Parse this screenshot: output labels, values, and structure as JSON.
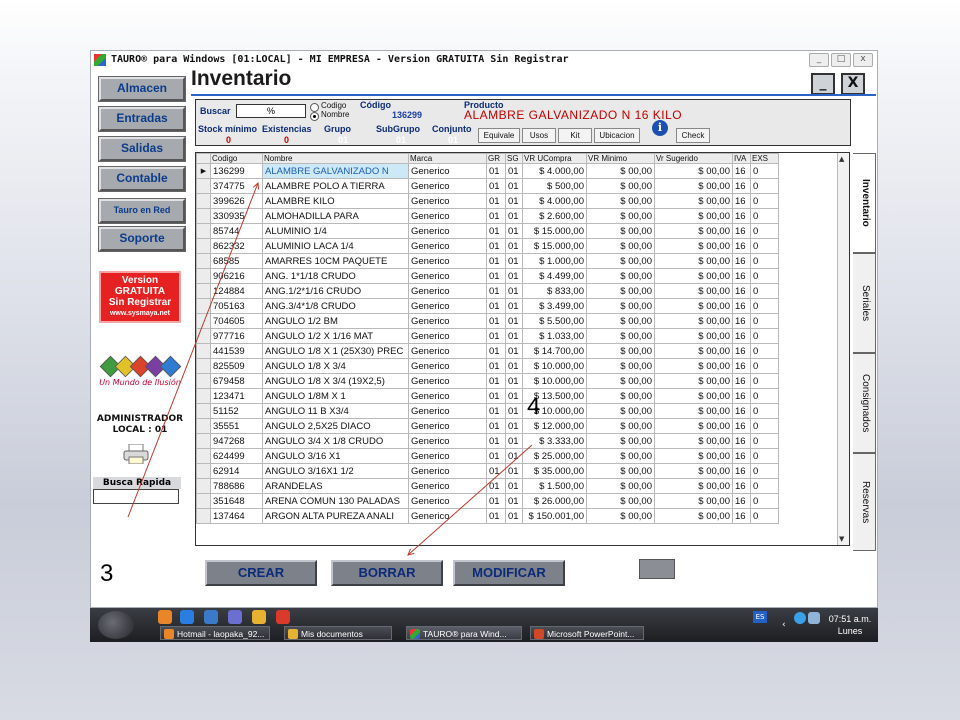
{
  "window": {
    "title": "TAURO® para Windows  [01:LOCAL] - MI EMPRESA - Version GRATUITA Sin Registrar",
    "controls": [
      "_",
      "□",
      "x"
    ]
  },
  "nav": {
    "items": [
      "Almacen",
      "Entradas",
      "Salidas",
      "Contable",
      "Tauro en Red",
      "Soporte"
    ],
    "promo": [
      "Version",
      "GRATUITA",
      "Sin Registrar",
      "www.sysmaya.net"
    ],
    "slogan": "Un Mundo de Ilusión",
    "user_line1": "ADMINISTRADOR",
    "user_line2": "LOCAL : 01",
    "quick_search_label": "Busca Rapida"
  },
  "page": {
    "title": "Inventario",
    "minimize": "_",
    "close": "X"
  },
  "header": {
    "buscar_label": "Buscar",
    "buscar_value": "%",
    "radio_codigo": "Codigo",
    "radio_nombre": "Nombre",
    "codigo_label": "Código",
    "codigo_value": "136299",
    "producto_label": "Producto",
    "producto_value": "ALAMBRE GALVANIZADO N 16 KILO",
    "stock_min_label": "Stock mínimo",
    "stock_min_value": "0",
    "existencias_label": "Existencias",
    "existencias_value": "0",
    "grupo_label": "Grupo",
    "grupo_value": "01",
    "subgrupo_label": "SubGrupo",
    "subgrupo_value": "01",
    "conjunto_label": "Conjunto",
    "conjunto_value": "01",
    "buttons": [
      "Equivale",
      "Usos",
      "Kit",
      "Ubicacion",
      "Check"
    ]
  },
  "grid": {
    "columns": [
      "Codigo",
      "Nombre",
      "Marca",
      "GR",
      "SG",
      "VR UCompra",
      "VR Minimo",
      "Vr Sugerido",
      "IVA",
      "EXS"
    ],
    "rows": [
      [
        "136299",
        "ALAMBRE GALVANIZADO N",
        "Generico",
        "01",
        "01",
        "$ 4.000,00",
        "$ 00,00",
        "$ 00,00",
        "16",
        "0"
      ],
      [
        "374775",
        "ALAMBRE POLO A TIERRA",
        "Generico",
        "01",
        "01",
        "$ 500,00",
        "$ 00,00",
        "$ 00,00",
        "16",
        "0"
      ],
      [
        "399626",
        "ALAMBRE KILO",
        "Generico",
        "01",
        "01",
        "$ 4.000,00",
        "$ 00,00",
        "$ 00,00",
        "16",
        "0"
      ],
      [
        "330935",
        "ALMOHADILLA PARA",
        "Generico",
        "01",
        "01",
        "$ 2.600,00",
        "$ 00,00",
        "$ 00,00",
        "16",
        "0"
      ],
      [
        "85744",
        "ALUMINIO 1/4",
        "Generico",
        "01",
        "01",
        "$ 15.000,00",
        "$ 00,00",
        "$ 00,00",
        "16",
        "0"
      ],
      [
        "862332",
        "ALUMINIO LACA 1/4",
        "Generico",
        "01",
        "01",
        "$ 15.000,00",
        "$ 00,00",
        "$ 00,00",
        "16",
        "0"
      ],
      [
        "68585",
        "AMARRES 10CM PAQUETE",
        "Generico",
        "01",
        "01",
        "$ 1.000,00",
        "$ 00,00",
        "$ 00,00",
        "16",
        "0"
      ],
      [
        "906216",
        "ANG. 1*1/18 CRUDO",
        "Generico",
        "01",
        "01",
        "$ 4.499,00",
        "$ 00,00",
        "$ 00,00",
        "16",
        "0"
      ],
      [
        "124884",
        "ANG.1/2*1/16 CRUDO",
        "Generico",
        "01",
        "01",
        "$ 833,00",
        "$ 00,00",
        "$ 00,00",
        "16",
        "0"
      ],
      [
        "705163",
        "ANG.3/4*1/8 CRUDO",
        "Generico",
        "01",
        "01",
        "$ 3.499,00",
        "$ 00,00",
        "$ 00,00",
        "16",
        "0"
      ],
      [
        "704605",
        "ANGULO 1/2 BM",
        "Generico",
        "01",
        "01",
        "$ 5.500,00",
        "$ 00,00",
        "$ 00,00",
        "16",
        "0"
      ],
      [
        "977716",
        "ANGULO 1/2 X 1/16 MAT",
        "Generico",
        "01",
        "01",
        "$ 1.033,00",
        "$ 00,00",
        "$ 00,00",
        "16",
        "0"
      ],
      [
        "441539",
        "ANGULO 1/8 X 1 (25X30) PREC",
        "Generico",
        "01",
        "01",
        "$ 14.700,00",
        "$ 00,00",
        "$ 00,00",
        "16",
        "0"
      ],
      [
        "825509",
        "ANGULO 1/8 X 3/4",
        "Generico",
        "01",
        "01",
        "$ 10.000,00",
        "$ 00,00",
        "$ 00,00",
        "16",
        "0"
      ],
      [
        "679458",
        "ANGULO 1/8 X 3/4 (19X2,5)",
        "Generico",
        "01",
        "01",
        "$ 10.000,00",
        "$ 00,00",
        "$ 00,00",
        "16",
        "0"
      ],
      [
        "123471",
        "ANGULO 1/8M X 1",
        "Generico",
        "01",
        "01",
        "$ 13.500,00",
        "$ 00,00",
        "$ 00,00",
        "16",
        "0"
      ],
      [
        "51152",
        "ANGULO 11 B X3/4",
        "Generico",
        "01",
        "01",
        "$ 10.000,00",
        "$ 00,00",
        "$ 00,00",
        "16",
        "0"
      ],
      [
        "35551",
        "ANGULO 2,5X25 DIACO",
        "Generico",
        "01",
        "01",
        "$ 12.000,00",
        "$ 00,00",
        "$ 00,00",
        "16",
        "0"
      ],
      [
        "947268",
        "ANGULO 3/4 X 1/8 CRUDO",
        "Generico",
        "01",
        "01",
        "$ 3.333,00",
        "$ 00,00",
        "$ 00,00",
        "16",
        "0"
      ],
      [
        "624499",
        "ANGULO 3/16 X1",
        "Generico",
        "01",
        "01",
        "$ 25.000,00",
        "$ 00,00",
        "$ 00,00",
        "16",
        "0"
      ],
      [
        "62914",
        "ANGULO 3/16X1 1/2",
        "Generico",
        "01",
        "01",
        "$ 35.000,00",
        "$ 00,00",
        "$ 00,00",
        "16",
        "0"
      ],
      [
        "788686",
        "ARANDELAS",
        "Generico",
        "01",
        "01",
        "$ 1.500,00",
        "$ 00,00",
        "$ 00,00",
        "16",
        "0"
      ],
      [
        "351648",
        "ARENA COMUN 130  PALADAS",
        "Generico",
        "01",
        "01",
        "$ 26.000,00",
        "$ 00,00",
        "$ 00,00",
        "16",
        "0"
      ],
      [
        "137464",
        "ARGON ALTA PUREZA ANALI",
        "Generico",
        "01",
        "01",
        "$ 150.001,00",
        "$ 00,00",
        "$ 00,00",
        "16",
        "0"
      ]
    ]
  },
  "side_tabs": [
    "Inventario",
    "Seriales",
    "Consignados",
    "Reservas"
  ],
  "actions": [
    "CREAR",
    "BORRAR",
    "MODIFICAR"
  ],
  "taskbar": {
    "windows": [
      "Hotmail - laopaka_92...",
      "Mis documentos",
      "TAURO® para Wind...",
      "Microsoft PowerPoint..."
    ],
    "language": "ES",
    "time": "07:51 a.m.",
    "day": "Lunes"
  },
  "annotations": {
    "label_a": "3",
    "label_b": "4"
  },
  "colors": {
    "accent": "#2b64c6",
    "brand_red": "#e52121",
    "value_red": "#c00000",
    "nav_text": "#0b3c8c"
  }
}
